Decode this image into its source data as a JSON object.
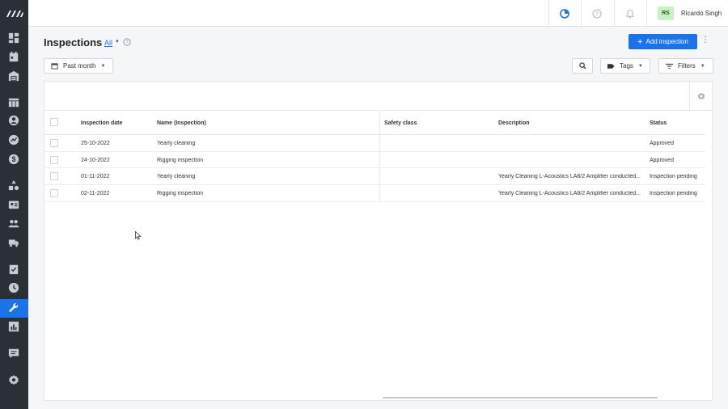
{
  "sidebar": {
    "items": [
      {
        "icon": "dashboard-icon"
      },
      {
        "icon": "calendar-icon"
      },
      {
        "icon": "warehouse-icon"
      },
      {
        "icon": "table-icon"
      },
      {
        "icon": "contacts-icon"
      },
      {
        "icon": "analytics-icon"
      },
      {
        "icon": "finance-icon"
      },
      {
        "icon": "equipment-icon"
      },
      {
        "icon": "crew-card-icon"
      },
      {
        "icon": "people-icon"
      },
      {
        "icon": "truck-icon"
      },
      {
        "icon": "tasks-icon"
      },
      {
        "icon": "clock-icon"
      },
      {
        "icon": "wrench-icon",
        "active": true
      },
      {
        "icon": "reports-icon"
      },
      {
        "icon": "messages-icon"
      },
      {
        "icon": "settings-icon"
      }
    ],
    "active_color": "#1a73e8"
  },
  "topbar": {
    "user_initials": "RS",
    "user_name": "Ricardo Singh"
  },
  "header": {
    "title": "Inspections",
    "view": "All"
  },
  "toolbar": {
    "period": "Past month",
    "tags": "Tags",
    "filters": "Filters",
    "add_label": "Add inspection"
  },
  "table": {
    "columns": [
      "Inspection date",
      "Name (Inspection)",
      "Safety class",
      "Description",
      "Status"
    ],
    "rows": [
      {
        "date": "25-10-2022",
        "name": "Yearly cleaning",
        "safety": "",
        "description": "",
        "status": "Approved"
      },
      {
        "date": "24-10-2022",
        "name": "Rigging inspection",
        "safety": "",
        "description": "",
        "status": "Approved"
      },
      {
        "date": "01-11-2022",
        "name": "Yearly cleaning",
        "safety": "",
        "description": "Yearly Cleaning L-Acoustics LA8/2 Amplifier conducted...",
        "status": "Inspection pending"
      },
      {
        "date": "02-11-2022",
        "name": "Rigging inspection",
        "safety": "",
        "description": "Yearly Cleaning L-Acoustics LA8/2 Amplifier conducted...",
        "status": "Inspection pending"
      }
    ]
  },
  "colors": {
    "accent": "#1a73e8",
    "sidebar_bg": "#2b2f36",
    "avatar_bg": "#c9f0c2"
  }
}
